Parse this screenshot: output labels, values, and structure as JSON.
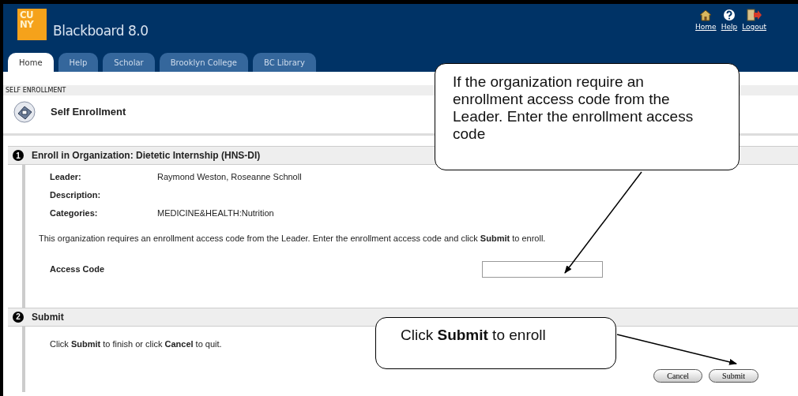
{
  "header": {
    "logo_top": "CU",
    "logo_bottom": "NY",
    "title": "Blackboard 8.0",
    "links": [
      {
        "label": "Home",
        "kind": "home"
      },
      {
        "label": "Help",
        "kind": "help"
      },
      {
        "label": "Logout",
        "kind": "logout"
      }
    ]
  },
  "tabs": [
    {
      "label": "Home",
      "selected": true
    },
    {
      "label": "Help",
      "selected": false
    },
    {
      "label": "Scholar",
      "selected": false
    },
    {
      "label": "Brooklyn College",
      "selected": false
    },
    {
      "label": "BC Library",
      "selected": false
    }
  ],
  "breadcrumb": "SELF ENROLLMENT",
  "page_title": "Self Enrollment",
  "steps": [
    {
      "number": "1",
      "title": "Enroll in Organization: Dietetic Internship (HNS-DI)",
      "fields": [
        {
          "label": "Leader:",
          "value": "Raymond Weston, Roseanne Schnoll"
        },
        {
          "label": "Description:"
        },
        {
          "label": "Categories:",
          "value": "MEDICINE&HEALTH:Nutrition"
        }
      ],
      "instruction": "This organization requires an enrollment access code from the Leader. Enter the enrollment access code and click **Submit** to enroll.",
      "input": {
        "label": "Access Code"
      }
    },
    {
      "number": "2",
      "title": "Submit",
      "instruction": "Click **Submit** to finish or click **Cancel** to quit."
    }
  ],
  "buttons": [
    {
      "label": "Cancel"
    },
    {
      "label": "Submit"
    }
  ],
  "callouts": [
    {
      "text": "If the organization require an enrollment access code from the Leader. Enter the enrollment access code"
    },
    {
      "text": "Click **Submit** to enroll"
    }
  ]
}
